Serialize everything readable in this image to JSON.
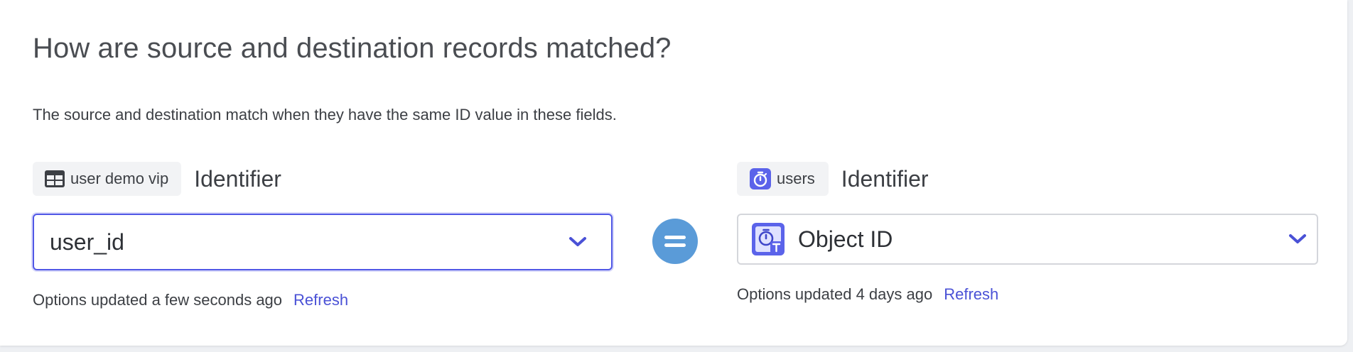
{
  "section": {
    "heading": "How are source and destination records matched?",
    "description": "The source and destination match when they have the same ID value in these fields."
  },
  "source": {
    "chip_label": "user demo vip",
    "chip_icon": "table-icon",
    "identifier_label": "Identifier",
    "selected_value": "user_id",
    "options_status": "Options updated a few seconds ago",
    "refresh_label": "Refresh"
  },
  "match_operator": {
    "icon": "equals-icon"
  },
  "destination": {
    "chip_label": "users",
    "chip_icon": "stopwatch-icon",
    "identifier_label": "Identifier",
    "selected_value": "Object ID",
    "selected_value_icon": "object-id-field-icon",
    "options_status": "Options updated 4 days ago",
    "refresh_label": "Refresh"
  },
  "colors": {
    "accent": "#5158e6",
    "link": "#4a51d6",
    "equals_badge": "#5a9bd8"
  }
}
